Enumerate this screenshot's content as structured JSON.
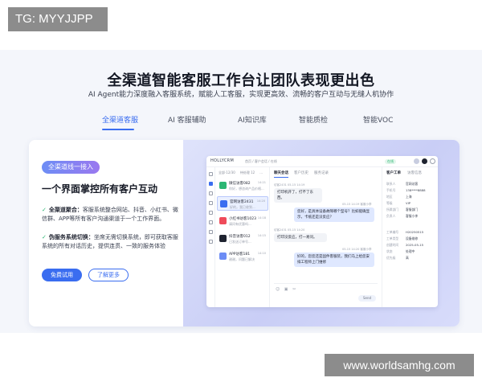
{
  "overlay": {
    "tg_badge": "TG: MYYJJPP",
    "watermark": "www.worldsamhg.com"
  },
  "hero": {
    "title": "全渠道智能客服工作台让团队表现更出色",
    "subtitle": "AI Agent能力深度融入客服系统，赋能人工客服，实现更高效、流畅的客户互动与无缝人机协作"
  },
  "nav": {
    "items": [
      "全渠道客服",
      "AI 客服辅助",
      "AI知识库",
      "智能质检",
      "智能VOC"
    ],
    "active_index": 0
  },
  "feature": {
    "pill": "全渠道线一接入",
    "title": "一个界面掌控所有客户互动",
    "bullets": [
      {
        "strong": "全渠道聚合：",
        "text": "客服系统整合网站、抖音、小红书、微信群、APP等所有客户沟通渠道于一个工作界面。"
      },
      {
        "strong": "伪服务系统切换：",
        "text": "坐席无需切换系统，即可获取客服系统的所有对话历史，提供连贯、一致的服务体验"
      }
    ],
    "primary_button": "免费试用",
    "secondary_button": "了解更多"
  },
  "app": {
    "logo": "HOLLYCRM",
    "breadcrumb": "首页 / 客户会话 / 在线",
    "status": "在线",
    "list_tabs": [
      "全部·12/30",
      "待处理 12",
      "..."
    ],
    "conversations": [
      {
        "name": "微信访客082",
        "msg": "你好，想咨询产品价格...",
        "time": "14:21",
        "color": "#2bb673"
      },
      {
        "name": "官网访客2431",
        "msg": "好的，我已收到...",
        "time": "14:20",
        "color": "#3a6df0",
        "active": true
      },
      {
        "name": "小红书访客1023",
        "msg": "请问有优惠吗...",
        "time": "14:18",
        "color": "#ef4b5a"
      },
      {
        "name": "抖音访客012",
        "msg": "已发送订单号...",
        "time": "14:15",
        "color": "#1f2330"
      },
      {
        "name": "APP访客181",
        "msg": "谢谢，问题已解决",
        "time": "14:10",
        "color": "#6d8df5"
      }
    ],
    "chat_tabs": [
      "聊天会话",
      "客户历史",
      "服务记录"
    ],
    "messages": [
      {
        "dir": "in",
        "meta": "访客2431  05-15 14:19",
        "text": "打印机开了，打不了东西。"
      },
      {
        "dir": "out",
        "meta": "05-15 14:19  客服小李",
        "text": "您好，是具体设备故障哪个型号？比如能确显示，卡纸还是没反应？"
      },
      {
        "dir": "in",
        "meta": "访客2431  05-15 14:20",
        "text": "打印没反应，打一易问。"
      },
      {
        "dir": "out",
        "meta": "05-15 14:20  客服小李",
        "text": "好的，您您还是固件客服装，我们马上给您安排工程师上门维修"
      }
    ],
    "send_label": "Send",
    "info_tabs": [
      "客户工单",
      "访客信息"
    ],
    "info_rows": [
      {
        "k": "联系人",
        "v": "官网访客"
      },
      {
        "k": "手机号",
        "v": "138****8888"
      },
      {
        "k": "地区",
        "v": "上海"
      },
      {
        "k": "等级",
        "v": "VIP"
      },
      {
        "k": "所属部门",
        "v": "客服部门"
      },
      {
        "k": "负责人",
        "v": "客服小李"
      },
      {
        "k": "工单编号",
        "v": "H20250515"
      },
      {
        "k": "工单类型",
        "v": "设备维修"
      },
      {
        "k": "创建时间",
        "v": "2025-05-15"
      },
      {
        "k": "状态",
        "v": "处理中"
      },
      {
        "k": "优先级",
        "v": "高"
      }
    ]
  }
}
